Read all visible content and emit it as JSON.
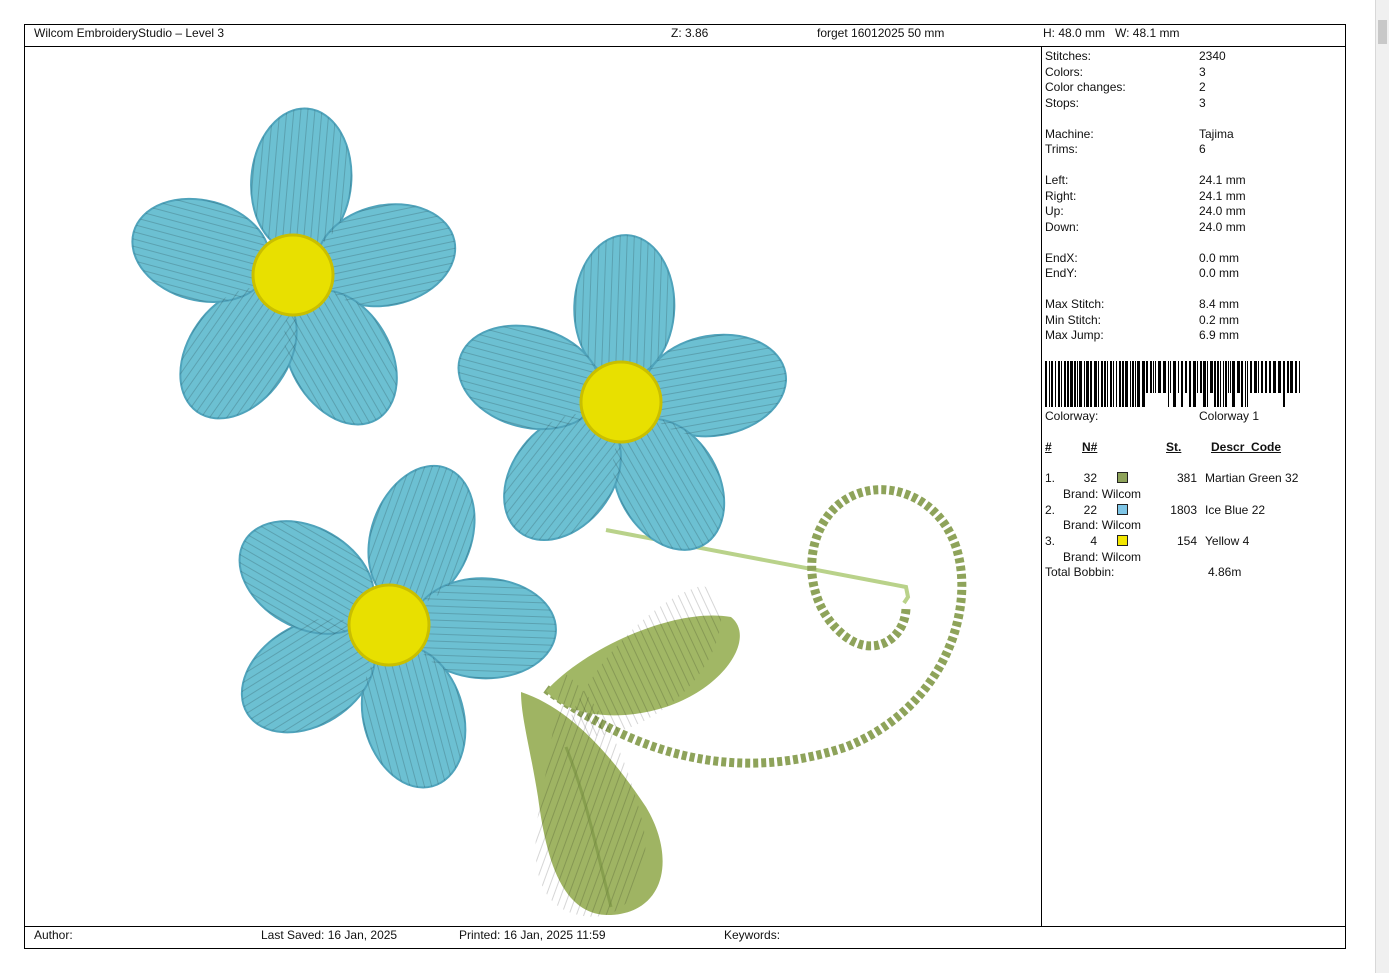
{
  "header": {
    "app_title": "Wilcom EmbroideryStudio – Level 3",
    "zoom": "Z: 3.86",
    "design_name": "forget 16012025 50 mm",
    "dimensions": "H: 48.0 mm   W: 48.1 mm"
  },
  "stats": [
    {
      "label": "Stitches:",
      "value": "2340"
    },
    {
      "label": "Colors:",
      "value": "3"
    },
    {
      "label": "Color changes:",
      "value": "2"
    },
    {
      "label": "Stops:",
      "value": "3"
    },
    {
      "label": "Machine:",
      "value": "Tajima"
    },
    {
      "label": "Trims:",
      "value": "6"
    },
    {
      "label": "Left:",
      "value": "24.1 mm"
    },
    {
      "label": "Right:",
      "value": "24.1 mm"
    },
    {
      "label": "Up:",
      "value": "24.0 mm"
    },
    {
      "label": "Down:",
      "value": "24.0 mm"
    },
    {
      "label": "EndX:",
      "value": "0.0 mm"
    },
    {
      "label": "EndY:",
      "value": "0.0 mm"
    },
    {
      "label": "Max Stitch:",
      "value": "8.4 mm"
    },
    {
      "label": "Min Stitch:",
      "value": "0.2 mm"
    },
    {
      "label": "Max Jump:",
      "value": "6.9 mm"
    }
  ],
  "colorway": {
    "label": "Colorway:",
    "value": "Colorway 1"
  },
  "color_table": {
    "headers": {
      "num": "#",
      "needle": "N#",
      "stitches": "St.",
      "description": "Descr_Code"
    },
    "rows": [
      {
        "index": "1.",
        "needle": "32",
        "color": "#8ea35a",
        "stitches": "381",
        "description": "Martian Green 32",
        "brand": "Brand: Wilcom"
      },
      {
        "index": "2.",
        "needle": "22",
        "color": "#7ec5e6",
        "stitches": "1803",
        "description": "Ice Blue 22",
        "brand": "Brand: Wilcom"
      },
      {
        "index": "3.",
        "needle": "4",
        "color": "#f2e600",
        "stitches": "154",
        "description": "Yellow 4",
        "brand": "Brand: Wilcom"
      }
    ]
  },
  "total_bobbin": {
    "label": "Total Bobbin:",
    "value": "4.86m"
  },
  "footer": {
    "author": "Author:",
    "last_saved": "Last Saved: 16 Jan, 2025",
    "printed": "Printed: 16 Jan, 2025 11:59",
    "keywords": "Keywords:"
  },
  "design_colors": {
    "petal": "#6cc0d2",
    "petal_dark": "#3f8ea6",
    "center": "#e8e000",
    "center_dark": "#b5a800",
    "leaf": "#a1b765",
    "leaf_dark": "#6f8a3a",
    "stem": "#b9d28a"
  }
}
